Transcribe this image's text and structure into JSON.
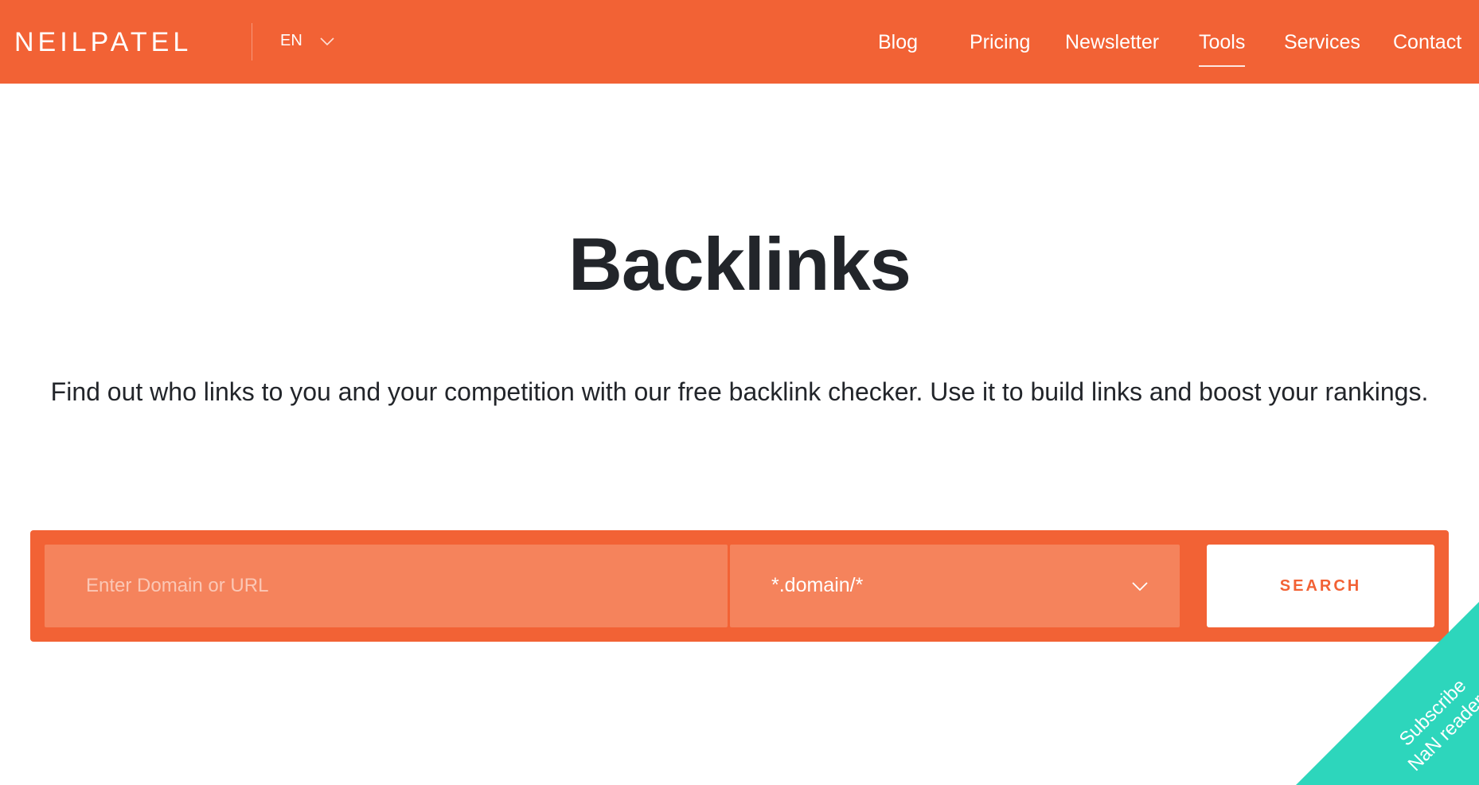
{
  "header": {
    "logo": "NEILPATEL",
    "language": "EN",
    "nav": [
      {
        "label": "Blog",
        "active": false
      },
      {
        "label": "Pricing",
        "active": false
      },
      {
        "label": "Newsletter",
        "active": false
      },
      {
        "label": "Tools",
        "active": true
      },
      {
        "label": "Services",
        "active": false
      },
      {
        "label": "Contact",
        "active": false
      }
    ]
  },
  "hero": {
    "title": "Backlinks",
    "subtitle": "Find out who links to you and your competition with our free backlink checker. Use it to build links and boost your rankings."
  },
  "search": {
    "placeholder": "Enter Domain or URL",
    "value": "",
    "scope_selected": "*.domain/*",
    "button_label": "SEARCH"
  },
  "subscribe": {
    "line1": "Subscribe",
    "line2": "NaN readers"
  },
  "colors": {
    "brand": "#f26235",
    "field": "#f5835c",
    "ribbon": "#2dd6bc",
    "title": "#22252a"
  }
}
